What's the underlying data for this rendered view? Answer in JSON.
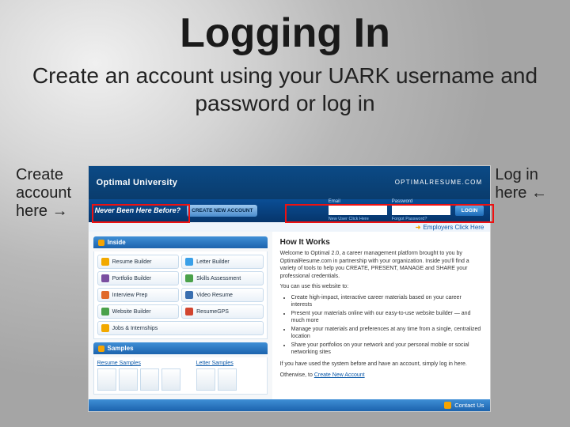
{
  "title": "Logging In",
  "subtitle": "Create an account using your UARK username and password or log in",
  "left_label": "Create account here →",
  "right_label": "Log in here ←",
  "banner": {
    "left": "Optimal University",
    "right": "OPTIMALRESUME.COM"
  },
  "bar": {
    "never_been": "Never Been Here Before?",
    "create_btn": "CREATE NEW ACCOUNT",
    "email_label": "Email",
    "pass_label": "Password",
    "new_user_link": "New User Click Here",
    "forgot_link": "Forgot Password?",
    "login_btn": "LOGIN"
  },
  "subbar": {
    "employers": "Employers Click Here"
  },
  "left_col": {
    "inside": "Inside",
    "tools": [
      {
        "label": "Resume Builder",
        "color": "#f2a900"
      },
      {
        "label": "Letter Builder",
        "color": "#3aa0e8"
      },
      {
        "label": "Portfolio Builder",
        "color": "#7a4ea0"
      },
      {
        "label": "Skills Assessment",
        "color": "#4aa14a"
      },
      {
        "label": "Interview Prep",
        "color": "#e06a2b"
      },
      {
        "label": "Video Resume",
        "color": "#3a6fb0"
      },
      {
        "label": "Website Builder",
        "color": "#4aa14a"
      },
      {
        "label": "ResumeGPS",
        "color": "#d2452f"
      }
    ],
    "jobs": "Jobs & Internships",
    "samples": "Samples",
    "resume_samples": "Resume Samples",
    "letter_samples": "Letter Samples"
  },
  "right_col": {
    "heading": "How It Works",
    "p1": "Welcome to Optimal 2.0, a career management platform brought to you by OptimalResume.com in partnership with your organization. Inside you'll find a variety of tools to help you CREATE, PRESENT, MANAGE and SHARE your professional credentials.",
    "p2": "You can use this website to:",
    "bullets": [
      "Create high-impact, interactive career materials based on your career interests",
      "Present your materials online with our easy-to-use website builder — and much more",
      "Manage your materials and preferences at any time from a single, centralized location",
      "Share your portfolios on your network and your personal mobile or social networking sites"
    ],
    "p3": "If you have used the system before and have an account, simply log in here.",
    "p4_prefix": "Otherwise, to ",
    "p4_link": "Create New Account"
  },
  "contact": "Contact Us"
}
